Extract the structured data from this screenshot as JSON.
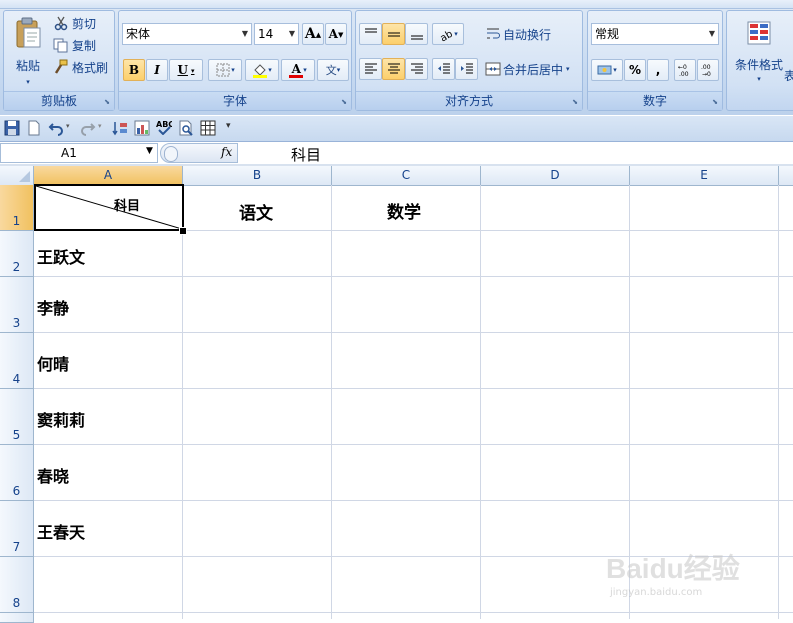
{
  "clipboard": {
    "group_label": "剪贴板",
    "paste_label": "粘贴",
    "cut_label": "剪切",
    "copy_label": "复制",
    "format_painter_label": "格式刷"
  },
  "font": {
    "group_label": "字体",
    "font_name": "宋体",
    "font_size": "14",
    "bold": "B",
    "italic": "I",
    "underline": "U",
    "grow": "A",
    "shrink": "A",
    "font_color_glyph": "A",
    "phonetic_glyph": "文"
  },
  "alignment": {
    "group_label": "对齐方式",
    "wrap_text_label": "自动换行",
    "merge_center_label": "合并后居中"
  },
  "number": {
    "group_label": "数字",
    "format_value": "常规",
    "percent_glyph": "%",
    "comma_glyph": ","
  },
  "styles": {
    "conditional_format_label": "条件格式",
    "table_label_partial": "表"
  },
  "formula_bar": {
    "name_box": "A1",
    "fx": "fx",
    "content": "科目"
  },
  "columns": [
    "A",
    "B",
    "C",
    "D",
    "E"
  ],
  "rows": [
    {
      "num": "1",
      "a": "科目",
      "b": "语文",
      "c": "数学"
    },
    {
      "num": "2",
      "a": "王跃文"
    },
    {
      "num": "3",
      "a": "李静"
    },
    {
      "num": "4",
      "a": "何晴"
    },
    {
      "num": "5",
      "a": "窦莉莉"
    },
    {
      "num": "6",
      "a": "春晓"
    },
    {
      "num": "7",
      "a": "王春天"
    },
    {
      "num": "8",
      "a": ""
    }
  ],
  "colors": {
    "ribbon_text": "#15428b",
    "selection_header": "#f6cf7d",
    "gridline": "#d0d7e5"
  },
  "watermark": {
    "brand": "Baidu经验",
    "url": "jingyan.baidu.com"
  }
}
